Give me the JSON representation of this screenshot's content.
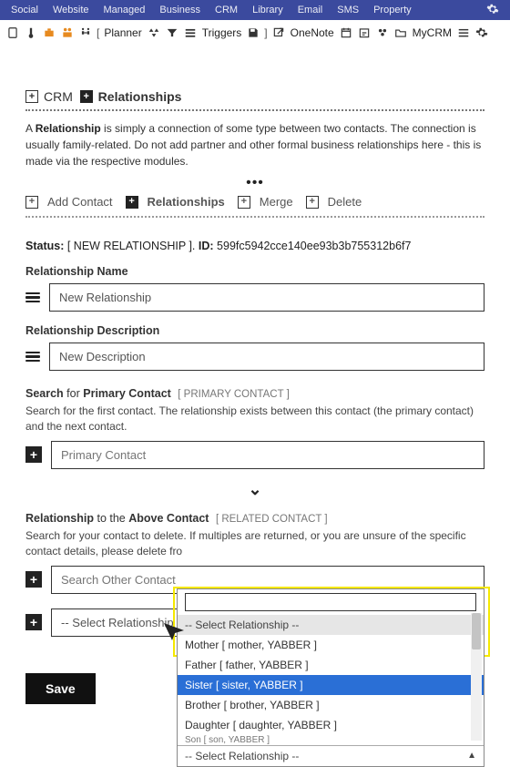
{
  "topnav": [
    "Social",
    "Website",
    "Managed",
    "Business",
    "CRM",
    "Library",
    "Email",
    "SMS",
    "Property"
  ],
  "toolbar": {
    "planner": "Planner",
    "triggers": "Triggers",
    "onenote": "OneNote",
    "mycrm": "MyCRM"
  },
  "header": {
    "crm": "CRM",
    "relationships": "Relationships"
  },
  "intro": {
    "bold": "Relationship",
    "rest": " is simply a connection of some type between two contacts. The connection is usually family-related. Do not add partner and other formal business relationships here - this is made via the respective modules."
  },
  "actions": {
    "add_contact": "Add Contact",
    "relationships": "Relationships",
    "merge": "Merge",
    "delete": "Delete"
  },
  "status": {
    "label": "Status:",
    "value": "[ NEW RELATIONSHIP ].",
    "id_label": "ID:",
    "id_value": "599fc5942cce140ee93b3b755312b6f7"
  },
  "fields": {
    "name_label": "Relationship Name",
    "name_value": "New Relationship",
    "desc_label": "Relationship Description",
    "desc_value": "New Description",
    "primary_label_a": "Search",
    "primary_label_b": " for ",
    "primary_label_c": "Primary Contact",
    "primary_sub": "[ PRIMARY CONTACT ]",
    "primary_help": "Search for the first contact. The relationship exists between this contact (the primary contact) and the next contact.",
    "primary_placeholder": "Primary Contact",
    "related_label_a": "Relationship",
    "related_label_b": " to the ",
    "related_label_c": "Above Contact",
    "related_sub": "[ RELATED CONTACT ]",
    "related_help": "Search for your contact to delete. If multiples are returned, or you are unsure of the specific contact details, please delete fro",
    "related_placeholder": "Search Other Contact",
    "relsel_placeholder": "-- Select Relationship"
  },
  "dropdown": {
    "placeholder": "-- Select Relationship --",
    "options": [
      "Mother [ mother, YABBER ]",
      "Father [ father, YABBER ]",
      "Sister [ sister, YABBER ]",
      "Brother [ brother, YABBER ]",
      "Daughter [ daughter, YABBER ]",
      "Son [ son, YABBER ]"
    ],
    "highlight_index": 2,
    "footer": "-- Select Relationship --"
  },
  "save": "Save"
}
